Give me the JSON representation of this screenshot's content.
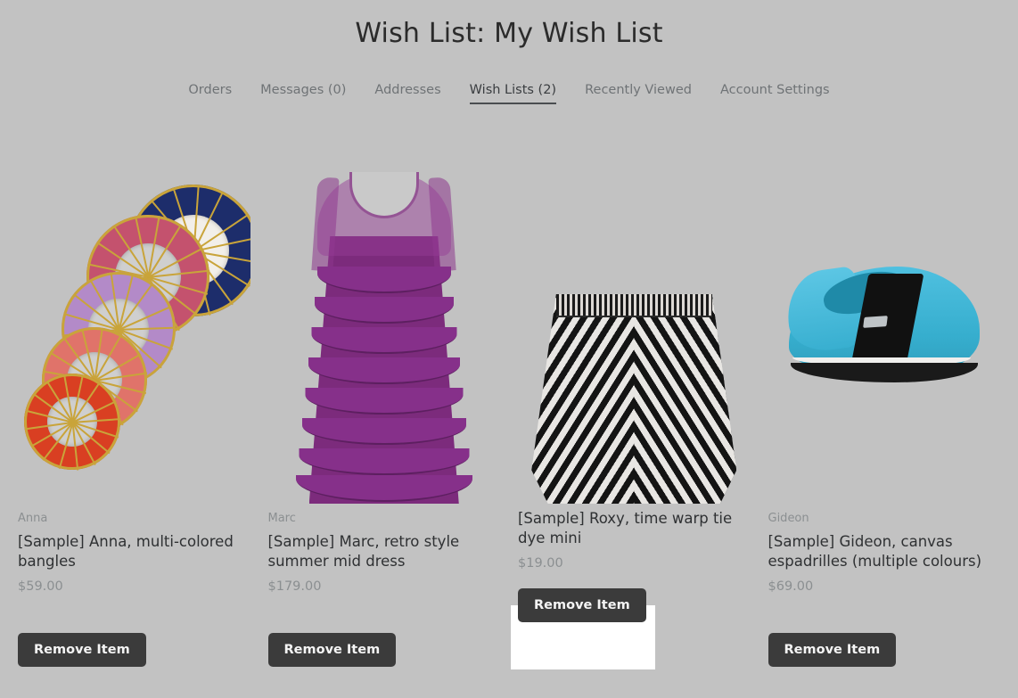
{
  "header": {
    "title": "Wish List: My Wish List"
  },
  "nav": {
    "tabs": [
      {
        "label": "Orders",
        "active": false
      },
      {
        "label": "Messages (0)",
        "active": false
      },
      {
        "label": "Addresses",
        "active": false
      },
      {
        "label": "Wish Lists (2)",
        "active": true
      },
      {
        "label": "Recently Viewed",
        "active": false
      },
      {
        "label": "Account Settings",
        "active": false
      }
    ]
  },
  "products": [
    {
      "brand": "Anna",
      "name": "[Sample] Anna, multi-colored bangles",
      "price": "$59.00",
      "remove_label": "Remove Item",
      "image": "bangles-image",
      "highlighted": false
    },
    {
      "brand": "Marc",
      "name": "[Sample] Marc, retro style summer mid dress",
      "price": "$179.00",
      "remove_label": "Remove Item",
      "image": "dress-image",
      "highlighted": false
    },
    {
      "brand": "",
      "name": "[Sample] Roxy, time warp tie dye mini",
      "price": "$19.00",
      "remove_label": "Remove Item",
      "image": "chevron-skirt-image",
      "highlighted": true
    },
    {
      "brand": "Gideon",
      "name": "[Sample] Gideon, canvas espadrilles (multiple colours)",
      "price": "$69.00",
      "remove_label": "Remove Item",
      "image": "espadrille-shoe-image",
      "highlighted": false
    }
  ],
  "colors": {
    "background": "#c2c2c2",
    "button_bg": "#3b3b3b",
    "button_text": "#f4f4f4",
    "title_text": "#2b2b2b",
    "tab_text": "#6f7376",
    "tab_active_text": "#3a3d40",
    "brand_text": "#8b8f91",
    "price_text": "#8b8f91",
    "highlight_box": "#ffffff"
  }
}
